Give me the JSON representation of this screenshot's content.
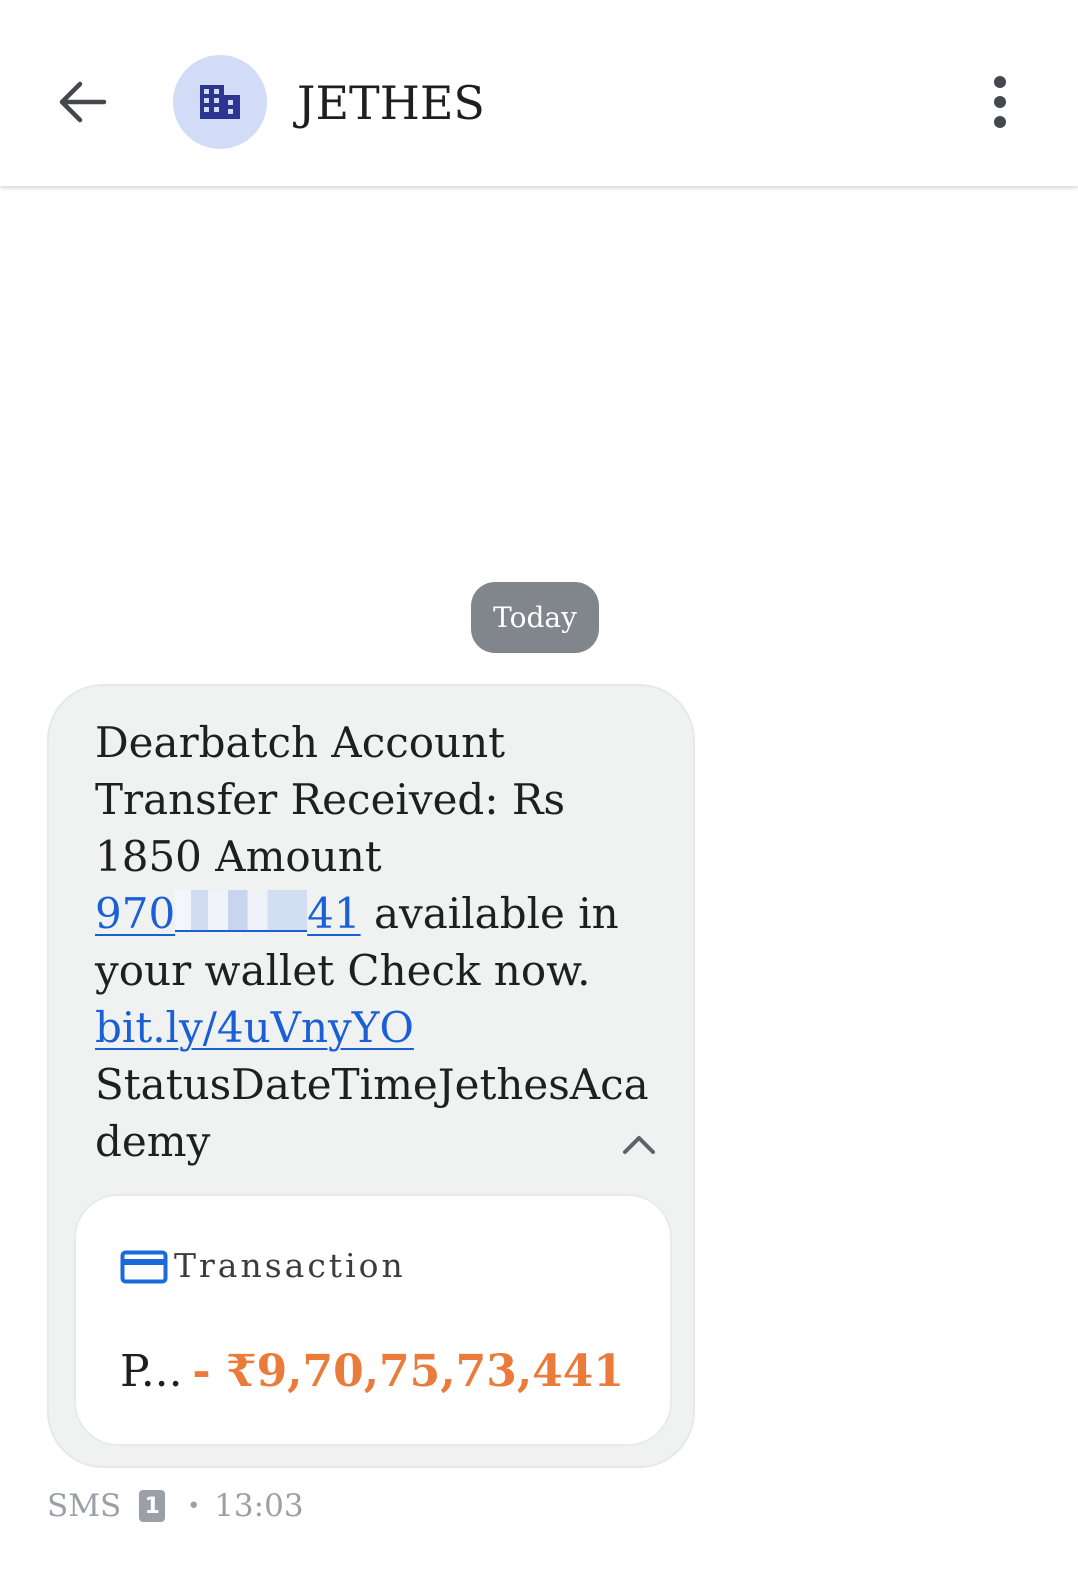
{
  "colors": {
    "avatar_bg": "#d3dcf7",
    "avatar_icon": "#2c3592",
    "chip_bg": "#80868b",
    "bubble_bg": "#f0f1f1",
    "link": "#1a5fd6",
    "amount": "#ea7b3b",
    "card_icon": "#1a6ad9",
    "meta": "#9aa0a6"
  },
  "header": {
    "back_icon": "arrow-left-icon",
    "avatar_icon": "building-icon",
    "contact_name": "JETHES",
    "more_icon": "more-vert-icon"
  },
  "date_chip": "Today",
  "message": {
    "line1": "Dearbatch Account",
    "line2": "Transfer Received: Rs",
    "line3": "1850 Amount",
    "phone_prefix": "970",
    "phone_suffix": "41",
    "line4_rest": " available in",
    "line5": "your wallet Check now.",
    "link": "bit.ly/4uVnyYO",
    "line7": "StatusDateTimeJethesAca",
    "line8": "demy",
    "collapse_icon": "chevron-up-icon"
  },
  "transaction_card": {
    "icon": "credit-card-icon",
    "label": "Transaction",
    "party": "P...",
    "amount": "- ₹9,70,75,73,441"
  },
  "meta": {
    "type": "SMS",
    "sim": "1",
    "time": "13:03"
  }
}
